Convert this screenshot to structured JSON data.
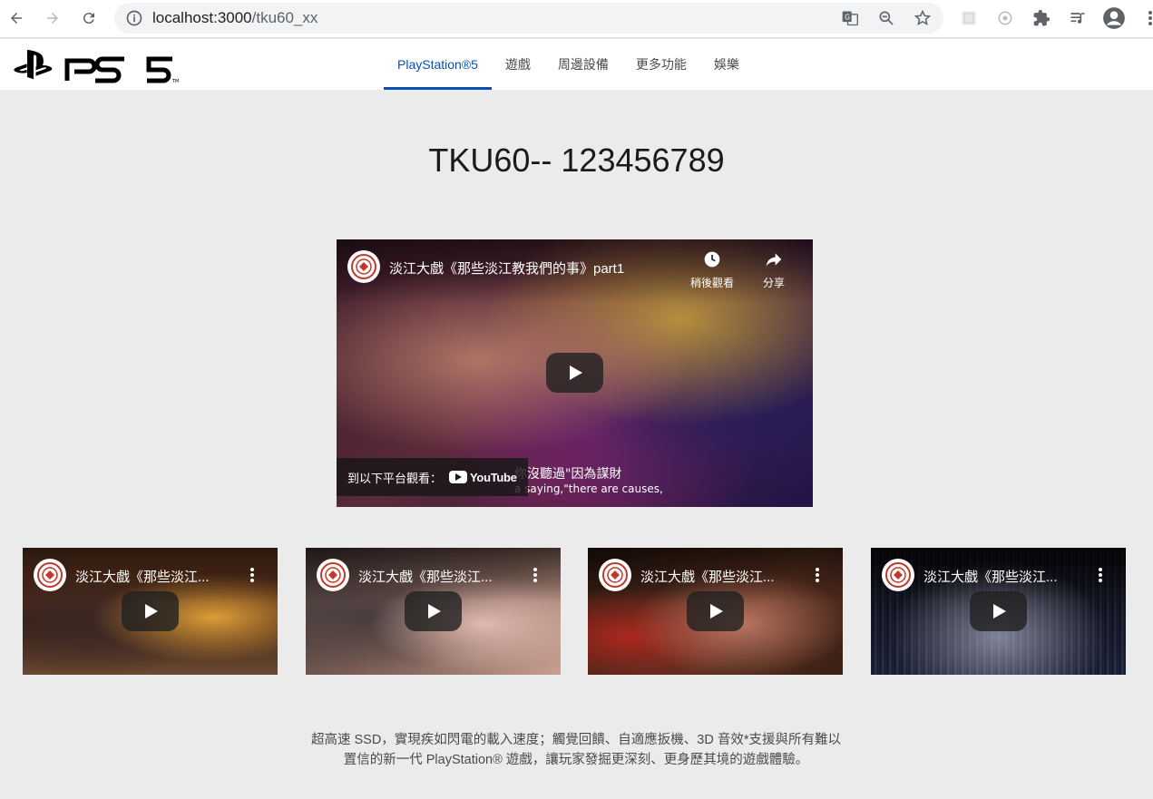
{
  "browser": {
    "url_host": "localhost:3000",
    "url_path": "/tku60_xx"
  },
  "site": {
    "logo_text": "PS5",
    "nav": [
      {
        "label": "PlayStation®5",
        "active": true
      },
      {
        "label": "遊戲",
        "active": false
      },
      {
        "label": "周邊設備",
        "active": false
      },
      {
        "label": "更多功能",
        "active": false
      },
      {
        "label": "娛樂",
        "active": false
      }
    ]
  },
  "main": {
    "title": "TKU60-- 123456789",
    "featured_video": {
      "title": "淡江大戲《那些淡江教我們的事》part1",
      "watch_later_label": "稍後觀看",
      "share_label": "分享",
      "watch_on_label": "到以下平台觀看：",
      "youtube_label": "YouTube",
      "subtitle_cn": "你沒聽過\"因為謀財",
      "subtitle_en": "a saying,\"there are causes,"
    },
    "thumbnails": [
      {
        "title": "淡江大戲《那些淡江..."
      },
      {
        "title": "淡江大戲《那些淡江..."
      },
      {
        "title": "淡江大戲《那些淡江..."
      },
      {
        "title": "淡江大戲《那些淡江..."
      }
    ],
    "description": "超高速 SSD，實現疾如閃電的載入速度；觸覺回饋、自適應扳機、3D 音效*支援與所有難以置信的新一代 PlayStation® 遊戲，讓玩家發掘更深刻、更身歷其境的遊戲體驗。"
  },
  "colors": {
    "accent": "#0b4fb3",
    "page_bg": "#ebebeb"
  }
}
